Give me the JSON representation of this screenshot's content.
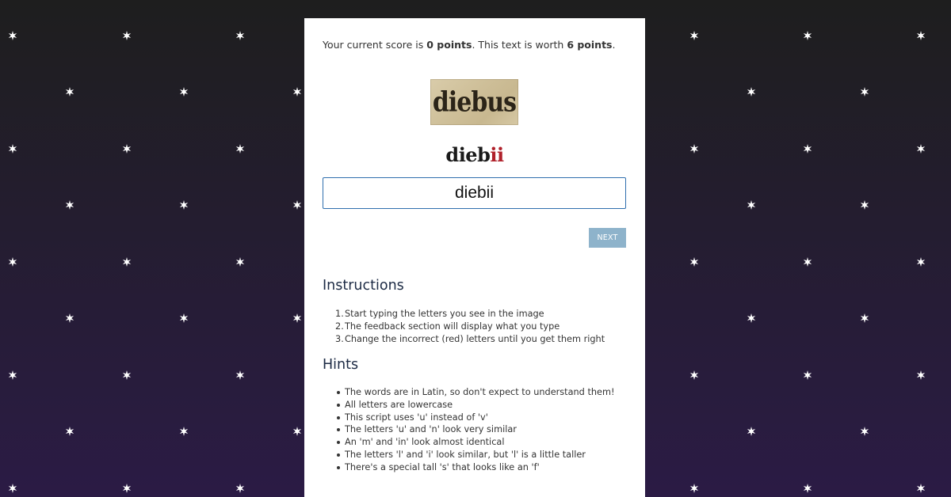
{
  "score": {
    "prefix": "Your current score is ",
    "points": "0 points",
    "middle": ".  This text is worth ",
    "worth": "6 points",
    "suffix": "."
  },
  "word_image": {
    "text": "diebus"
  },
  "feedback": {
    "correct_part": "dieb",
    "incorrect_part": "ii",
    "correct_color": "#1a1a1a",
    "incorrect_color": "#b0212b"
  },
  "answer_input": {
    "value": "diebii"
  },
  "next_button": {
    "label": "NEXT"
  },
  "instructions": {
    "title": "Instructions",
    "items": [
      "Start typing the letters you see in the image",
      "The feedback section will display what you type",
      "Change the incorrect (red) letters until you get them right"
    ]
  },
  "hints": {
    "title": "Hints",
    "items": [
      "The words are in Latin, so don't expect to understand them!",
      "All letters are lowercase",
      "This script uses 'u' instead of 'v'",
      "The letters 'u' and 'n' look very similar",
      "An 'm' and 'in' look almost identical",
      "The letters 'l' and 'i' look similar, but 'l' is a little taller",
      "There's a special tall 's' that looks like an 'f'"
    ]
  },
  "background": {
    "star_icon": "six-point-star-icon",
    "star_color": "#ffffff"
  }
}
